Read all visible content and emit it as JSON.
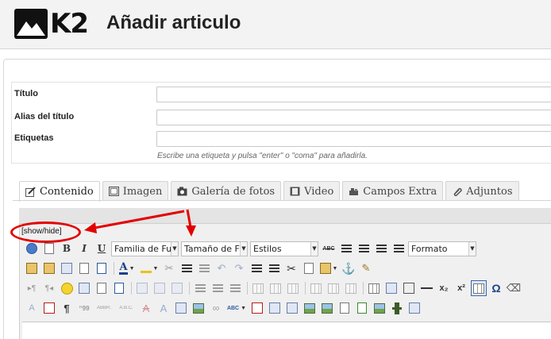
{
  "header": {
    "logo_text": "K2",
    "title": "Añadir articulo"
  },
  "form": {
    "title_label": "Título",
    "alias_label": "Alias del título",
    "tags_label": "Etiquetas",
    "tags_hint": "Escribe una etiqueta y pulsa \"enter\" o \"coma\" para añadirla."
  },
  "tabs": [
    {
      "label": "Contenido",
      "icon": "edit-icon",
      "active": true
    },
    {
      "label": "Imagen",
      "icon": "image-icon",
      "active": false
    },
    {
      "label": "Galería de fotos",
      "icon": "camera-icon",
      "active": false
    },
    {
      "label": "Video",
      "icon": "film-icon",
      "active": false
    },
    {
      "label": "Campos Extra",
      "icon": "puzzle-icon",
      "active": false
    },
    {
      "label": "Adjuntos",
      "icon": "paperclip-icon",
      "active": false
    }
  ],
  "editor": {
    "toggle_label": "[show/hide]",
    "font_family": "Familia de Fu",
    "font_size": "Tamaño de F",
    "styles": "Estilos",
    "format": "Formato",
    "strike_label": "ABC",
    "bold_label": "B",
    "italic_label": "I",
    "underline_label": "U",
    "omega_label": "Ω",
    "sub_label": "x₂",
    "sup_label": "x²",
    "pilcrow_label": "¶",
    "quote_label": "‘‘99",
    "abbr_label": "ABBR.",
    "acronym_label": "A.B.C.",
    "spell_label": "ABC"
  },
  "colors": {
    "annotation_red": "#e20000",
    "tab_bg": "#efefef",
    "toolbar_bg": "#f0f0f0"
  }
}
